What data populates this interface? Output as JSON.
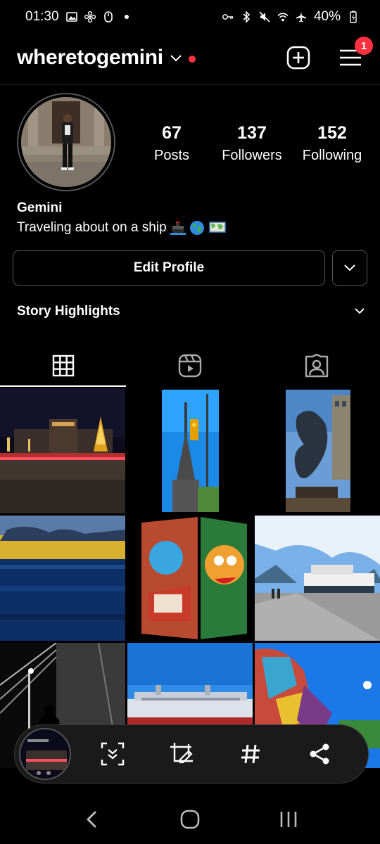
{
  "status_bar": {
    "time": "01:30",
    "battery": "40%"
  },
  "header": {
    "username": "wheretogemini",
    "notification_count": "1"
  },
  "profile": {
    "stats": [
      {
        "value": "67",
        "label": "Posts"
      },
      {
        "value": "137",
        "label": "Followers"
      },
      {
        "value": "152",
        "label": "Following"
      }
    ],
    "name": "Gemini",
    "bio": "Traveling about on a ship"
  },
  "actions": {
    "edit_profile_label": "Edit Profile"
  },
  "highlights": {
    "title": "Story Highlights"
  },
  "tabs": [
    {
      "name": "grid",
      "icon": "grid-icon",
      "active": true
    },
    {
      "name": "reels",
      "icon": "reels-icon",
      "active": false
    },
    {
      "name": "tagged",
      "icon": "tagged-icon",
      "active": false
    }
  ],
  "grid_posts": [
    "night-plaza-christmas-tree",
    "columbus-monument-traffic-light",
    "abstract-metal-sculpture",
    "sunset-over-sea",
    "graffiti-mural",
    "cruise-ship-at-dock",
    "bw-bridge-silhouette",
    "cruise-ship-blue-sky",
    "colorful-mosaic-sculpture"
  ],
  "share_bar": {
    "actions": [
      "scroll-capture-icon",
      "crop-edit-icon",
      "hashtag-icon",
      "share-icon"
    ]
  },
  "colors": {
    "accent_red": "#ff3040",
    "background": "#000000",
    "divider": "#262626"
  }
}
